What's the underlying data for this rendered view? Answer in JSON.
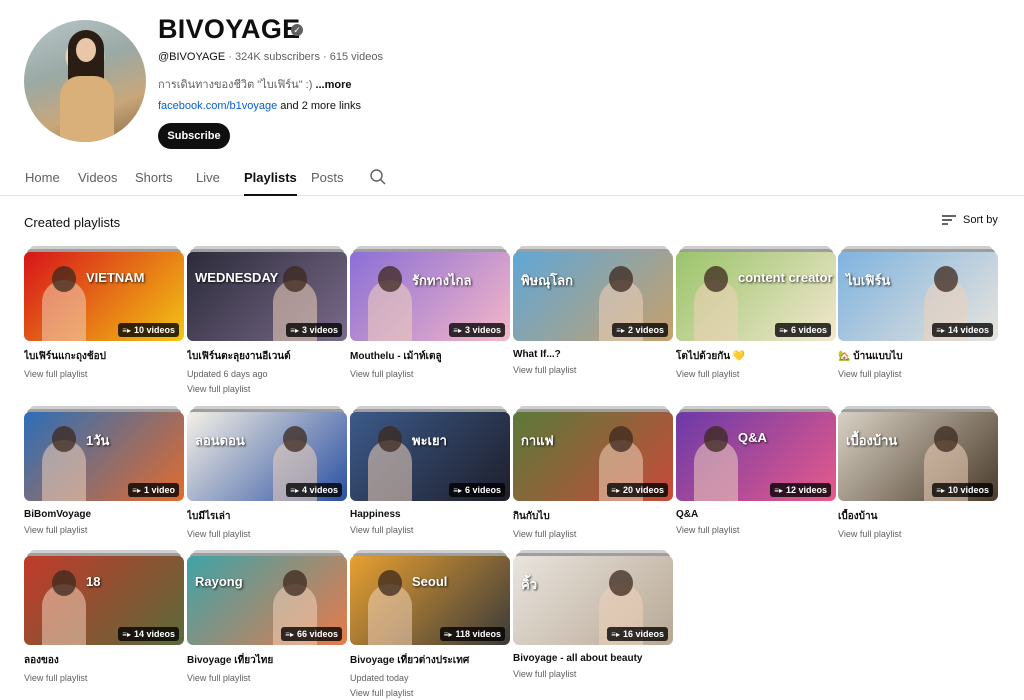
{
  "channel": {
    "title": "BIVOYAGE",
    "handle": "@BIVOYAGE",
    "stats": " · 324K subscribers · 615 videos",
    "description": "การเดินทางของชีวิต \"ไบเฟิร์น\" :) ",
    "more": "...more",
    "link": "facebook.com/b1voyage",
    "more_links": " and 2 more links",
    "subscribe_label": "Subscribe"
  },
  "tabs": [
    {
      "label": "Home"
    },
    {
      "label": "Videos"
    },
    {
      "label": "Shorts"
    },
    {
      "label": "Live"
    },
    {
      "label": "Playlists"
    },
    {
      "label": "Posts"
    }
  ],
  "active_tab": "Playlists",
  "section": {
    "title": "Created playlists",
    "sort_label": "Sort by"
  },
  "view_full": "View full playlist",
  "playlists": [
    {
      "title": "ไบเฟิร์นแกะถุงช้อป",
      "count": "10 videos",
      "updated": "",
      "thumb_text": "VIETNAM",
      "colors": [
        "#d7141a",
        "#f3c614"
      ]
    },
    {
      "title": "ไบเฟิร์นตะลุยงานอีเวนต์",
      "count": "3 videos",
      "updated": "Updated 6 days ago",
      "thumb_text": "WEDNESDAY",
      "colors": [
        "#2b2b3a",
        "#7a6a8a"
      ]
    },
    {
      "title": "Mouthelu - เม้าท์เตลู",
      "count": "3 videos",
      "updated": "",
      "thumb_text": "รักทางไกล",
      "colors": [
        "#8a6fd6",
        "#f5b6c7"
      ]
    },
    {
      "title": "What If...?",
      "count": "2 videos",
      "updated": "",
      "thumb_text": "พิษณุโลก",
      "colors": [
        "#5fa7d8",
        "#c7a06a"
      ]
    },
    {
      "title": "โตไปด้วยกัน 💛",
      "count": "6 videos",
      "updated": "",
      "thumb_text": "content creator",
      "colors": [
        "#9ac46a",
        "#f2e7cf"
      ]
    },
    {
      "title": "🏡 บ้านแบบไบ",
      "count": "14 videos",
      "updated": "",
      "thumb_text": "ไบเฟิร์น",
      "colors": [
        "#7fb3e0",
        "#e8e4dc"
      ]
    },
    {
      "title": "BiBomVoyage",
      "count": "1 video",
      "updated": "",
      "thumb_text": "1วัน",
      "colors": [
        "#2c6fb8",
        "#e36b2c"
      ]
    },
    {
      "title": "ไบมีไรเล่า",
      "count": "4 videos",
      "updated": "",
      "thumb_text": "ลอนดอน",
      "colors": [
        "#f4f0e6",
        "#2a4fa1"
      ]
    },
    {
      "title": "Happiness",
      "count": "6 videos",
      "updated": "",
      "thumb_text": "พะเยา",
      "colors": [
        "#3b5a8a",
        "#1e1e2a"
      ]
    },
    {
      "title": "กินกับไบ",
      "count": "20 videos",
      "updated": "",
      "thumb_text": "กาแฟ",
      "colors": [
        "#5a7a3a",
        "#c94a3a"
      ]
    },
    {
      "title": "Q&A",
      "count": "12 videos",
      "updated": "",
      "thumb_text": "Q&A",
      "colors": [
        "#6a3aa8",
        "#e85a8a"
      ]
    },
    {
      "title": "เบื้องบ้าน",
      "count": "10 videos",
      "updated": "",
      "thumb_text": "เบื้องบ้าน",
      "colors": [
        "#d9d2c4",
        "#4a3a2a"
      ]
    },
    {
      "title": "ลองของ",
      "count": "14 videos",
      "updated": "",
      "thumb_text": "18",
      "colors": [
        "#c23a2a",
        "#5a6a3a"
      ]
    },
    {
      "title": "Bivoyage เที่ยวไทย",
      "count": "66 videos",
      "updated": "",
      "thumb_text": "Rayong",
      "colors": [
        "#3fa3a8",
        "#e87a4a"
      ]
    },
    {
      "title": "Bivoyage เที่ยวต่างประเทศ",
      "count": "118 videos",
      "updated": "Updated today",
      "thumb_text": "Seoul",
      "colors": [
        "#e8a030",
        "#3a3a3a"
      ]
    },
    {
      "title": "Bivoyage - all about beauty",
      "count": "16 videos",
      "updated": "",
      "thumb_text": "คิ้ว",
      "colors": [
        "#e9e4de",
        "#b8a894"
      ]
    }
  ]
}
